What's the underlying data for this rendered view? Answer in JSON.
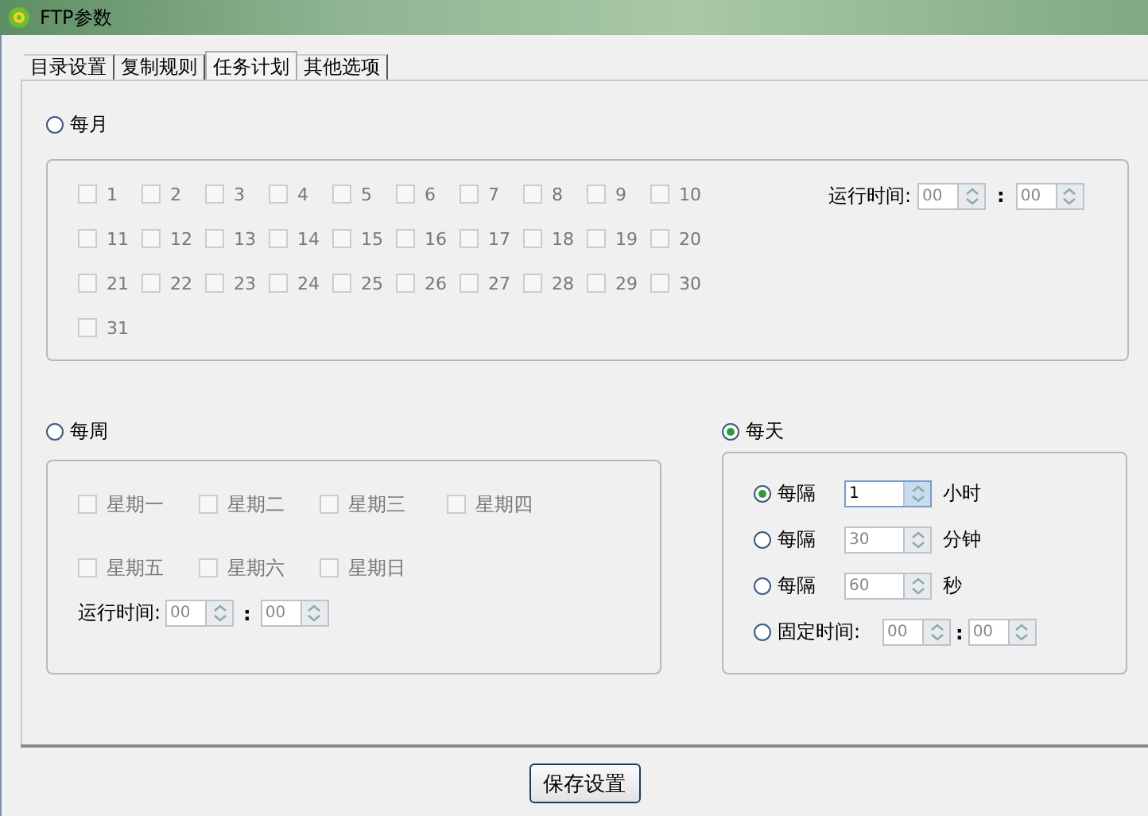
{
  "window": {
    "title": "FTP参数"
  },
  "tabs": [
    {
      "label": "目录设置",
      "selected": false
    },
    {
      "label": "复制规则",
      "selected": false
    },
    {
      "label": "任务计划",
      "selected": true
    },
    {
      "label": "其他选项",
      "selected": false
    }
  ],
  "monthly": {
    "label": "每月",
    "selected": false,
    "disabled": true,
    "days": [
      {
        "label": "1",
        "checked": false
      },
      {
        "label": "2",
        "checked": false
      },
      {
        "label": "3",
        "checked": false
      },
      {
        "label": "4",
        "checked": false
      },
      {
        "label": "5",
        "checked": false
      },
      {
        "label": "6",
        "checked": false
      },
      {
        "label": "7",
        "checked": false
      },
      {
        "label": "8",
        "checked": false
      },
      {
        "label": "9",
        "checked": false
      },
      {
        "label": "10",
        "checked": false
      },
      {
        "label": "11",
        "checked": false
      },
      {
        "label": "12",
        "checked": false
      },
      {
        "label": "13",
        "checked": false
      },
      {
        "label": "14",
        "checked": false
      },
      {
        "label": "15",
        "checked": false
      },
      {
        "label": "16",
        "checked": false
      },
      {
        "label": "17",
        "checked": false
      },
      {
        "label": "18",
        "checked": false
      },
      {
        "label": "19",
        "checked": false
      },
      {
        "label": "20",
        "checked": false
      },
      {
        "label": "21",
        "checked": false
      },
      {
        "label": "22",
        "checked": false
      },
      {
        "label": "23",
        "checked": false
      },
      {
        "label": "24",
        "checked": false
      },
      {
        "label": "25",
        "checked": false
      },
      {
        "label": "26",
        "checked": false
      },
      {
        "label": "27",
        "checked": false
      },
      {
        "label": "28",
        "checked": false
      },
      {
        "label": "29",
        "checked": false
      },
      {
        "label": "30",
        "checked": false
      },
      {
        "label": "31",
        "checked": false
      }
    ],
    "time_label": "运行时间:",
    "hour": "00",
    "separator": ":",
    "minute": "00"
  },
  "weekly": {
    "label": "每周",
    "selected": false,
    "disabled": true,
    "days": [
      {
        "label": "星期一",
        "checked": false
      },
      {
        "label": "星期二",
        "checked": false
      },
      {
        "label": "星期三",
        "checked": false
      },
      {
        "label": "星期四",
        "checked": false
      },
      {
        "label": "星期五",
        "checked": false
      },
      {
        "label": "星期六",
        "checked": false
      },
      {
        "label": "星期日",
        "checked": false
      }
    ],
    "time_label": "运行时间:",
    "hour": "00",
    "separator": ":",
    "minute": "00"
  },
  "daily": {
    "label": "每天",
    "selected": true,
    "options": [
      {
        "kind": "interval",
        "label": "每隔",
        "selected": true,
        "value": "1",
        "unit": "小时"
      },
      {
        "kind": "interval",
        "label": "每隔",
        "selected": false,
        "value": "30",
        "unit": "分钟"
      },
      {
        "kind": "interval",
        "label": "每隔",
        "selected": false,
        "value": "60",
        "unit": "秒"
      },
      {
        "kind": "time",
        "label": "固定时间:",
        "selected": false,
        "hour": "00",
        "separator": ":",
        "minute": "00"
      }
    ]
  },
  "save_button": "保存设置"
}
